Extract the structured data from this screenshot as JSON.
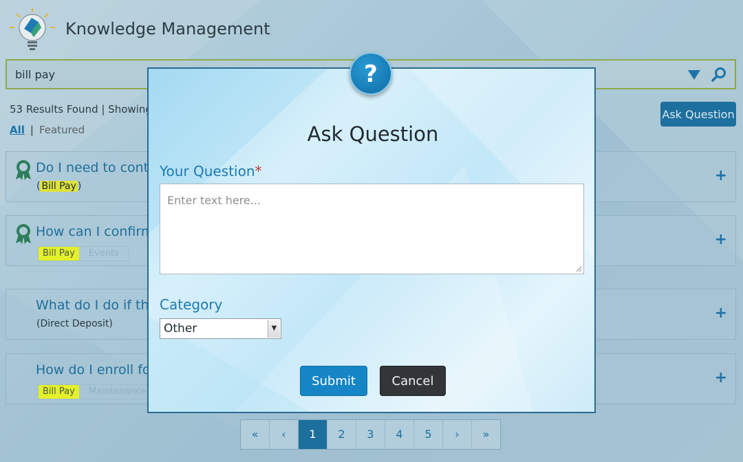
{
  "header": {
    "title": "Knowledge Management"
  },
  "search": {
    "value": "bill pay"
  },
  "results": {
    "summary": "53 Results Found | Showing"
  },
  "filters": {
    "all": "All",
    "separator": "|",
    "featured": "Featured"
  },
  "ask_question_button": "Ask Question",
  "cards": [
    {
      "title": "Do I need to contac",
      "sub_prefix": "(",
      "sub_highlight": "Bill Pay",
      "sub_suffix": ")",
      "featured": true,
      "expand": "+"
    },
    {
      "title": "How can I confirm t",
      "tags": [
        "Bill Pay",
        "Events"
      ],
      "featured": true,
      "expand": "+"
    },
    {
      "title": "What do I do if the",
      "sub": "(Direct Deposit)",
      "featured": false,
      "expand": "+"
    },
    {
      "title": "How do I enroll for",
      "tags": [
        "Bill Pay",
        "Maintenance"
      ],
      "featured": false,
      "expand": "+"
    }
  ],
  "pagination": {
    "first": "«",
    "prev": "‹",
    "pages": [
      "1",
      "2",
      "3",
      "4",
      "5"
    ],
    "active_page": "1",
    "next": "›",
    "last": "»"
  },
  "modal": {
    "title": "Ask Question",
    "icon": "?",
    "question_label": "Your Question",
    "required_marker": "*",
    "question_placeholder": "Enter text here...",
    "category_label": "Category",
    "category_value": "Other",
    "submit_label": "Submit",
    "cancel_label": "Cancel"
  },
  "colors": {
    "accent": "#1d73a8",
    "highlight": "#dfe33a",
    "submit": "#1585c5",
    "cancel": "#333638"
  },
  "icons": [
    "lightbulb-logo-icon",
    "dropdown-arrow-icon",
    "search-icon",
    "award-ribbon-icon",
    "question-mark-icon",
    "expand-plus-icon"
  ]
}
